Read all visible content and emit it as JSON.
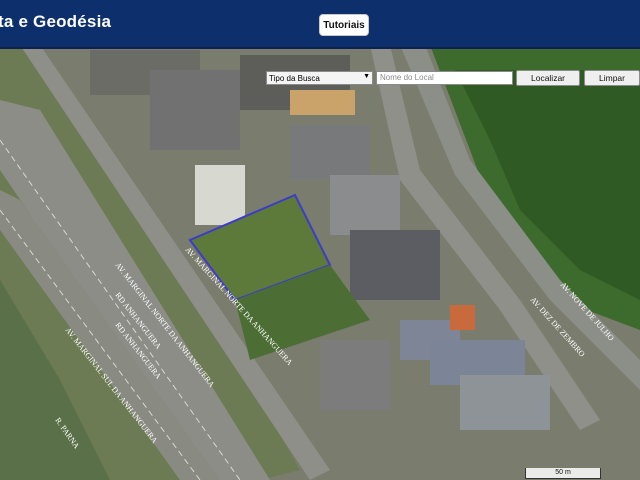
{
  "header": {
    "title": "ta e Geodésia",
    "tutorials_label": "Tutoriais"
  },
  "search": {
    "type_select": "Tipo da Busca",
    "place_placeholder": "Nome do Local",
    "locate_label": "Localizar",
    "clear_label": "Limpar"
  },
  "map": {
    "street_labels": [
      "AV. MARGINAL NORTE DA ANHANGUERA",
      "AV. MARGINAL NORTE DA ANHANGUERA",
      "RD ANHANGUERA",
      "RD ANHANGUERA",
      "AV. MARGINAL SUL DA ANHANGUERA",
      "R. PARNA",
      "AV. NOVE DE JULHO",
      "AV. DEZ DE ZEMBRO"
    ],
    "scale_label": "50 m",
    "colors": {
      "header": "#0d2f6b",
      "parcel_outline": "#3c3ccc",
      "vegetation": "#3f6a2c",
      "road": "#8c8f88"
    }
  }
}
